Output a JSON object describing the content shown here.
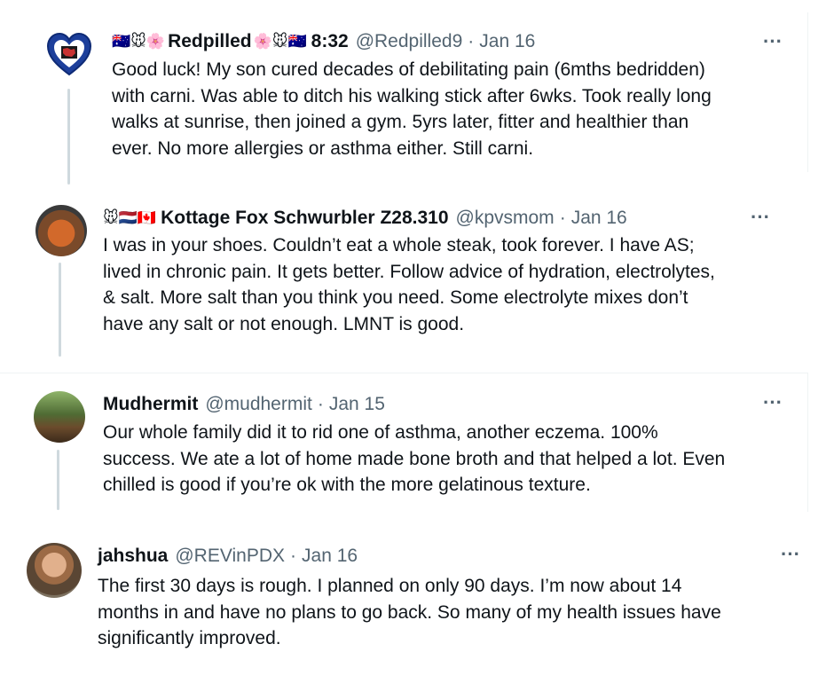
{
  "replies": [
    {
      "name_prefix_emoji": "🇦🇺🐭🌸",
      "name": "Redpilled",
      "name_suffix_emoji": "🌸🐭🇦🇺",
      "name_tail": "8:32",
      "handle": "@Redpilled9",
      "date": "Jan 16",
      "text_lines": [
        "Good luck!  My son cured decades of debilitating pain (6mths bedridden)",
        "with carni.  Was able to ditch his walking stick after 6wks. Took really long",
        "walks at sunrise, then joined a gym. 5yrs later, fitter and healthier than",
        "ever.  No more allergies or asthma either. Still carni."
      ]
    },
    {
      "name_prefix_emoji": "🐭🇳🇱🇨🇦",
      "name": "Kottage Fox Schwurbler Z28.310",
      "handle": "@kpvsmom",
      "date": "Jan 16",
      "text_lines": [
        "I was in your shoes.  Couldn’t eat a whole steak, took forever. I have AS;",
        "lived in chronic pain. It gets better. Follow advice of hydration, electrolytes,",
        "& salt. More salt than you think you need. Some electrolyte mixes don’t",
        "have any salt or not enough. LMNT is good."
      ]
    },
    {
      "name": "Mudhermit",
      "handle": "@mudhermit",
      "date": "Jan 15",
      "text_lines": [
        "Our whole family did it to rid one of asthma, another eczema. 100%",
        "success. We ate a lot of home made bone broth and that helped a lot. Even",
        "chilled is good if you’re ok with the more gelatinous texture."
      ]
    },
    {
      "name": "jahshua",
      "handle": "@REVinPDX",
      "date": "Jan 16",
      "text_lines": [
        "The first 30 days is rough. I planned on only 90 days. I’m now about 14",
        "months in and have no plans to go back. So many of my health issues have",
        "significantly improved."
      ]
    }
  ],
  "dot_separator": "·",
  "more_label": "···"
}
